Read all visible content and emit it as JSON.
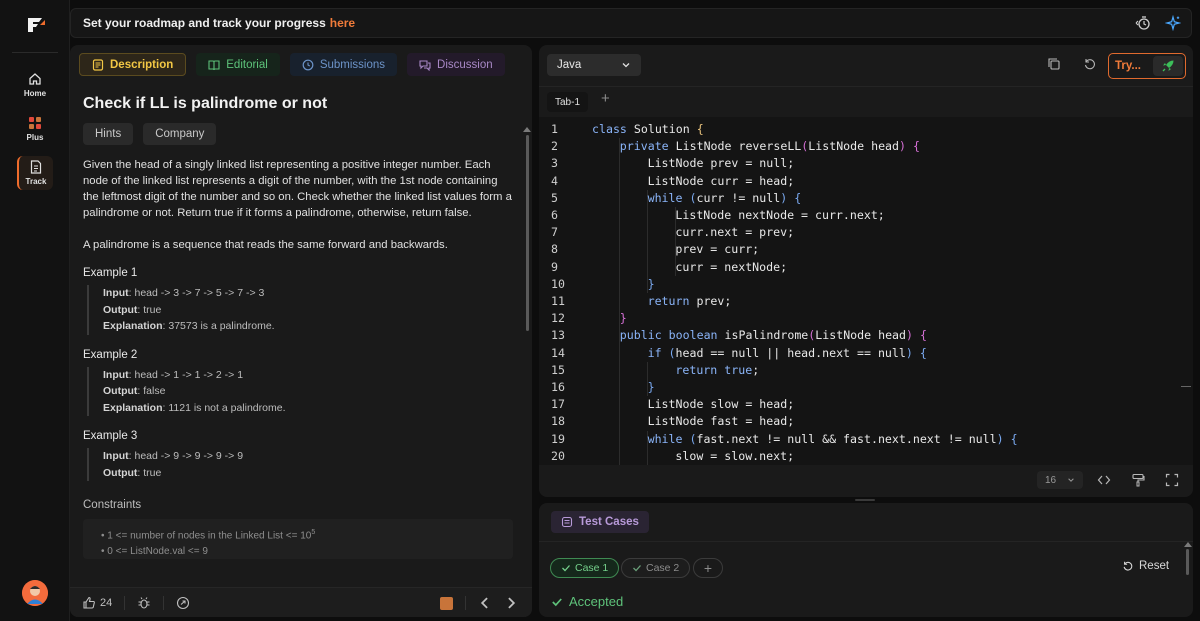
{
  "rail": {
    "items": [
      {
        "label": "Home",
        "icon": "home-icon"
      },
      {
        "label": "Plus",
        "icon": "plus-tiles-icon"
      },
      {
        "label": "Track",
        "icon": "track-doc-icon"
      }
    ],
    "accent": "#ef6c2c"
  },
  "topbar": {
    "message": "Set your roadmap and track your progress",
    "link": "here"
  },
  "left": {
    "tabs": [
      {
        "label": "Description"
      },
      {
        "label": "Editorial"
      },
      {
        "label": "Submissions"
      },
      {
        "label": "Discussion"
      }
    ],
    "title": "Check if LL is palindrome or not",
    "chips": [
      "Hints",
      "Company"
    ],
    "description": "Given the head of a singly linked list representing a positive integer number. Each node of the linked list represents a digit of the number, with the 1st node containing the leftmost digit of the number and so on. Check whether the linked list values form a palindrome or not. Return true if it forms a palindrome, otherwise, return false.",
    "description2": "A palindrome is a sequence that reads the same forward and backwards.",
    "examples": [
      {
        "title": "Example 1",
        "input_label": "Input",
        "input": ": head -> 3 -> 7 -> 5 -> 7 -> 3",
        "output_label": "Output",
        "output": ": true",
        "expl_label": "Explanation",
        "expl": ": 37573 is a palindrome."
      },
      {
        "title": "Example 2",
        "input_label": "Input",
        "input": ": head -> 1 -> 1 -> 2 -> 1",
        "output_label": "Output",
        "output": ": false",
        "expl_label": "Explanation",
        "expl": ": 1121 is not a palindrome."
      },
      {
        "title": "Example 3",
        "input_label": "Input",
        "input": ": head -> 9 -> 9 -> 9 -> 9",
        "output_label": "Output",
        "output": ":  true"
      }
    ],
    "constraints_title": "Constraints",
    "constraint1": "1 <= number of nodes in the Linked List <= 10",
    "constraint1_sup": "5",
    "constraint2": "0 <= ListNode.val <= 9",
    "footer": {
      "likes": "24"
    }
  },
  "editor": {
    "language": "Java",
    "try_label": "Try...",
    "tab": "Tab-1",
    "font_size": "16",
    "lines": [
      {
        "n": "1",
        "indent": 0,
        "parts": [
          [
            "kw",
            "class"
          ],
          [
            "t",
            " Solution "
          ],
          [
            "br1",
            "{"
          ]
        ]
      },
      {
        "n": "2",
        "indent": 1,
        "parts": [
          [
            "kw",
            "private"
          ],
          [
            "t",
            " ListNode reverseLL"
          ],
          [
            "br2",
            "("
          ],
          [
            "t",
            "ListNode head"
          ],
          [
            "br2",
            ")"
          ],
          [
            "t",
            " "
          ],
          [
            "br2",
            "{"
          ]
        ]
      },
      {
        "n": "3",
        "indent": 2,
        "parts": [
          [
            "t",
            "ListNode prev = null;"
          ]
        ]
      },
      {
        "n": "4",
        "indent": 2,
        "parts": [
          [
            "t",
            "ListNode curr = head;"
          ]
        ]
      },
      {
        "n": "5",
        "indent": 2,
        "parts": [
          [
            "kw",
            "while"
          ],
          [
            "t",
            " "
          ],
          [
            "br3",
            "("
          ],
          [
            "t",
            "curr != null"
          ],
          [
            "br3",
            ")"
          ],
          [
            "t",
            " "
          ],
          [
            "br3",
            "{"
          ]
        ]
      },
      {
        "n": "6",
        "indent": 3,
        "parts": [
          [
            "t",
            "ListNode nextNode = curr.next;"
          ]
        ]
      },
      {
        "n": "7",
        "indent": 3,
        "parts": [
          [
            "t",
            "curr.next = prev;"
          ]
        ]
      },
      {
        "n": "8",
        "indent": 3,
        "parts": [
          [
            "t",
            "prev = curr;"
          ]
        ]
      },
      {
        "n": "9",
        "indent": 3,
        "parts": [
          [
            "t",
            "curr = nextNode;"
          ]
        ]
      },
      {
        "n": "10",
        "indent": 2,
        "parts": [
          [
            "br3",
            "}"
          ]
        ]
      },
      {
        "n": "11",
        "indent": 2,
        "parts": [
          [
            "kw",
            "return"
          ],
          [
            "t",
            " prev;"
          ]
        ]
      },
      {
        "n": "12",
        "indent": 1,
        "parts": [
          [
            "br2",
            "}"
          ]
        ]
      },
      {
        "n": "13",
        "indent": 1,
        "parts": [
          [
            "kw",
            "public"
          ],
          [
            "t",
            " "
          ],
          [
            "kw",
            "boolean"
          ],
          [
            "t",
            " isPalindrome"
          ],
          [
            "br2",
            "("
          ],
          [
            "t",
            "ListNode head"
          ],
          [
            "br2",
            ")"
          ],
          [
            "t",
            " "
          ],
          [
            "br2",
            "{"
          ]
        ]
      },
      {
        "n": "14",
        "indent": 2,
        "parts": [
          [
            "kw",
            "if"
          ],
          [
            "t",
            " "
          ],
          [
            "br3",
            "("
          ],
          [
            "t",
            "head == null || head.next == null"
          ],
          [
            "br3",
            ")"
          ],
          [
            "t",
            " "
          ],
          [
            "br3",
            "{"
          ]
        ]
      },
      {
        "n": "15",
        "indent": 3,
        "parts": [
          [
            "kw",
            "return"
          ],
          [
            "t",
            " "
          ],
          [
            "kw",
            "true"
          ],
          [
            "t",
            ";"
          ]
        ]
      },
      {
        "n": "16",
        "indent": 2,
        "parts": [
          [
            "br3",
            "}"
          ]
        ]
      },
      {
        "n": "17",
        "indent": 2,
        "parts": [
          [
            "t",
            "ListNode slow = head;"
          ]
        ]
      },
      {
        "n": "18",
        "indent": 2,
        "parts": [
          [
            "t",
            "ListNode fast = head;"
          ]
        ]
      },
      {
        "n": "19",
        "indent": 2,
        "parts": [
          [
            "kw",
            "while"
          ],
          [
            "t",
            " "
          ],
          [
            "br3",
            "("
          ],
          [
            "t",
            "fast.next != null && fast.next.next != null"
          ],
          [
            "br3",
            ")"
          ],
          [
            "t",
            " "
          ],
          [
            "br3",
            "{"
          ]
        ]
      },
      {
        "n": "20",
        "indent": 3,
        "parts": [
          [
            "t",
            "slow = slow.next;"
          ]
        ]
      }
    ]
  },
  "tests": {
    "tab": "Test Cases",
    "cases": [
      "Case 1",
      "Case 2"
    ],
    "reset": "Reset",
    "status": "Accepted"
  }
}
